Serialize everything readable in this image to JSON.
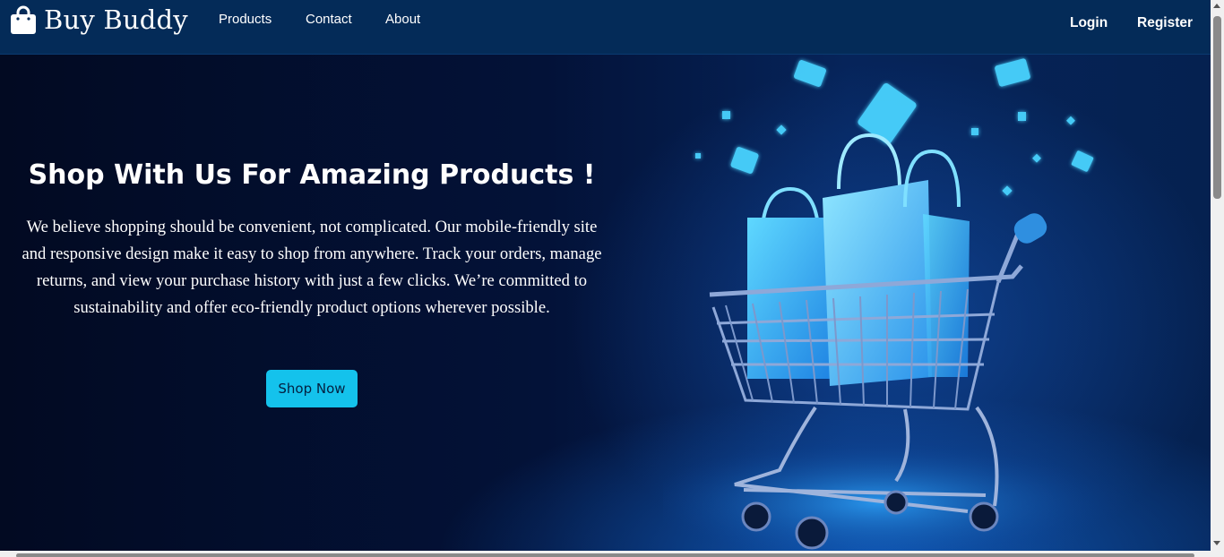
{
  "brand": {
    "name": "Buy Buddy",
    "icon": "shopping-bag-icon"
  },
  "nav": {
    "links": [
      "Products",
      "Contact",
      "About"
    ],
    "login": "Login",
    "register": "Register"
  },
  "hero": {
    "title": "Shop With Us For Amazing Products !",
    "text": "We believe shopping should be convenient, not complicated. Our mobile-friendly site and responsive design make it easy to shop from anywhere. Track your orders, manage returns, and view your purchase history with just a few clicks. We’re committed to sustainability and offer eco-friendly product options wherever possible.",
    "button": "Shop Now",
    "image": "shopping-cart-with-bags-illustration"
  },
  "colors": {
    "navbar": "#042b58",
    "hero_background": "#031238",
    "button": "#14c2ec",
    "accent_glow": "#3fd6ff"
  }
}
